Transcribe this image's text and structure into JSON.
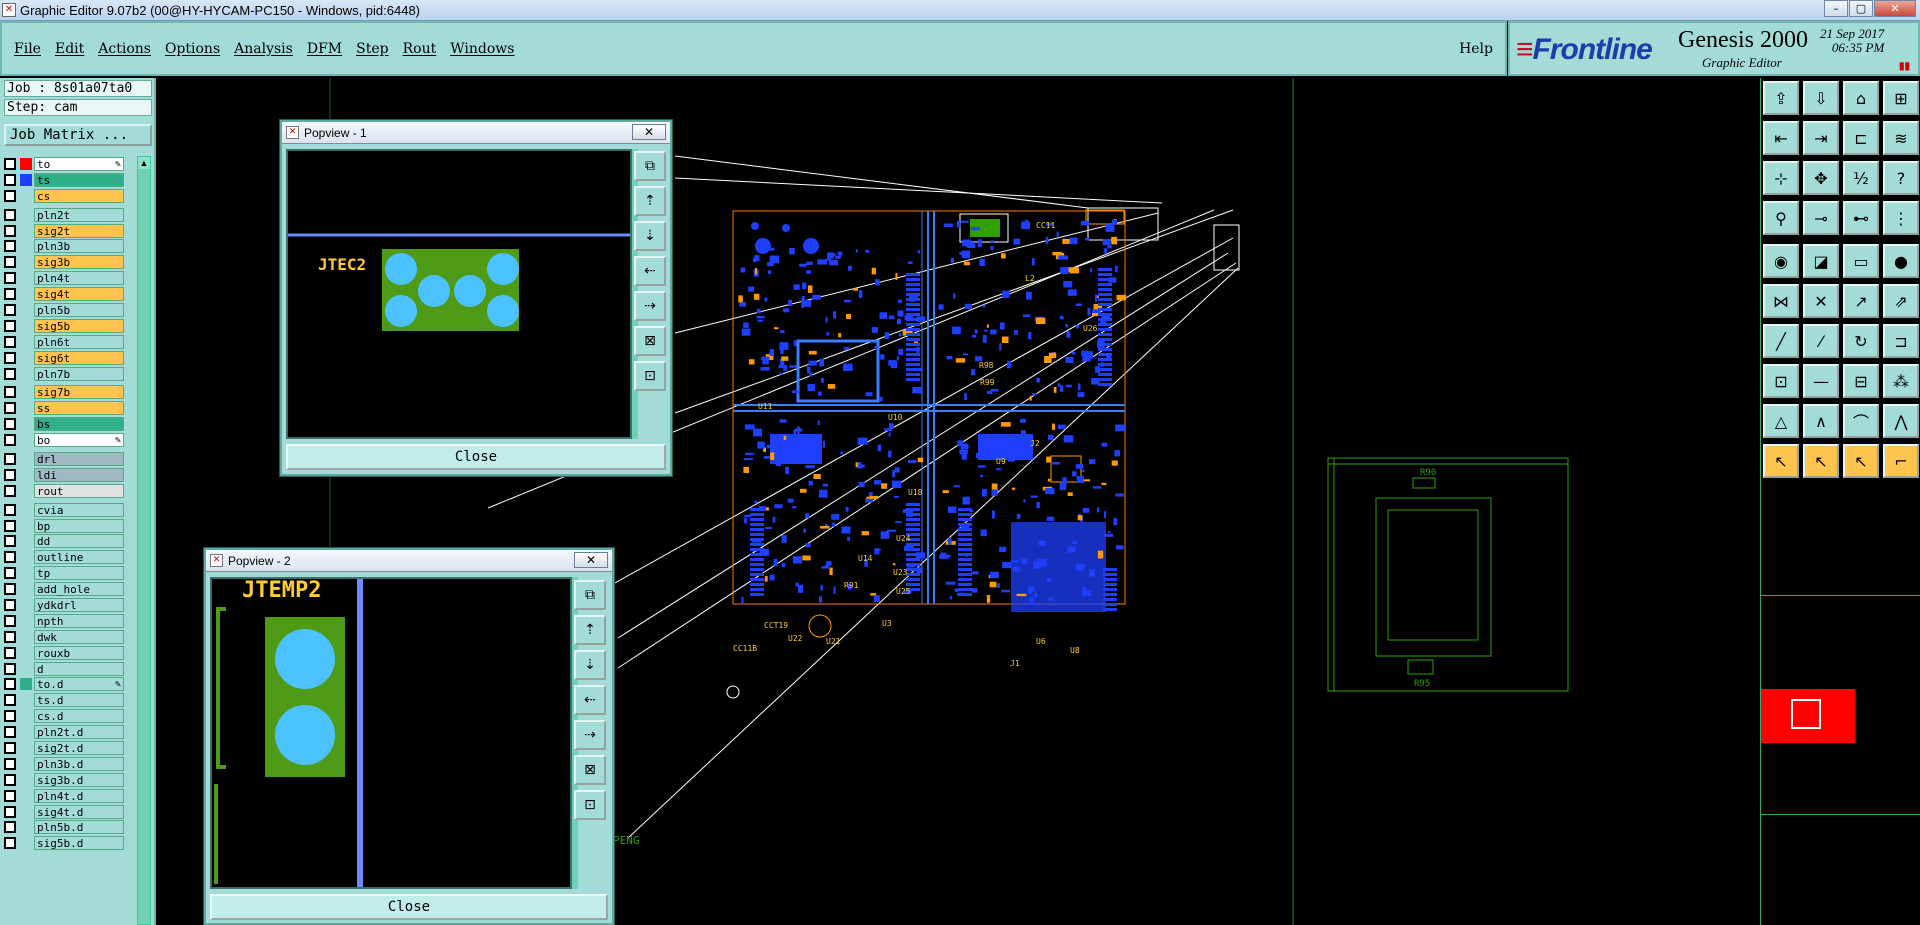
{
  "window": {
    "title": "Graphic Editor 9.07b2 (00@HY-HYCAM-PC150 - Windows, pid:6448)",
    "minimize": "–",
    "maximize": "▢",
    "close": "✕"
  },
  "menu": {
    "items": [
      "File",
      "Edit",
      "Actions",
      "Options",
      "Analysis",
      "DFM",
      "Step",
      "Rout",
      "Windows"
    ],
    "help": "Help"
  },
  "brand": {
    "logo": "Frontline",
    "product": "Genesis 2000",
    "subtitle": "Graphic Editor",
    "date": "21 Sep 2017",
    "time": "06:35 PM"
  },
  "job": {
    "job_label": "Job : 8s01a07ta0",
    "step_label": "Step: cam",
    "matrix_button": "Job Matrix ..."
  },
  "layers": [
    {
      "name": "to",
      "swatch": "#ff0000",
      "bg": "#ffffff",
      "edit": true
    },
    {
      "name": "ts",
      "swatch": "#1f3fff",
      "bg": "#2fae8a"
    },
    {
      "name": "cs",
      "swatch": "",
      "bg": "#ffc44d"
    },
    {
      "name": "pln2t",
      "swatch": "",
      "bg": "#a3dcd6",
      "gap": true
    },
    {
      "name": "sig2t",
      "swatch": "",
      "bg": "#ffc44d"
    },
    {
      "name": "pln3b",
      "swatch": "",
      "bg": "#a3dcd6"
    },
    {
      "name": "sig3b",
      "swatch": "",
      "bg": "#ffc44d"
    },
    {
      "name": "pln4t",
      "swatch": "",
      "bg": "#a3dcd6"
    },
    {
      "name": "sig4t",
      "swatch": "",
      "bg": "#ffc44d"
    },
    {
      "name": "pln5b",
      "swatch": "",
      "bg": "#a3dcd6"
    },
    {
      "name": "sig5b",
      "swatch": "",
      "bg": "#ffc44d"
    },
    {
      "name": "pln6t",
      "swatch": "",
      "bg": "#a3dcd6"
    },
    {
      "name": "sig6t",
      "swatch": "",
      "bg": "#ffc44d"
    },
    {
      "name": "pln7b",
      "swatch": "",
      "bg": "#a3dcd6"
    },
    {
      "name": "sig7b",
      "swatch": "",
      "bg": "#ffc44d",
      "gap": true
    },
    {
      "name": "ss",
      "swatch": "",
      "bg": "#ffc44d"
    },
    {
      "name": "bs",
      "swatch": "",
      "bg": "#2fae8a"
    },
    {
      "name": "bo",
      "swatch": "",
      "bg": "#ffffff",
      "edit": true
    },
    {
      "name": "drl",
      "swatch": "",
      "bg": "#9fb8c4",
      "gap": true
    },
    {
      "name": "ldi",
      "swatch": "",
      "bg": "#9fb8c4"
    },
    {
      "name": "rout",
      "swatch": "",
      "bg": "#e2e2e2"
    },
    {
      "name": "cvia",
      "swatch": "",
      "bg": "#a3dcd6",
      "gap": true
    },
    {
      "name": "bp",
      "swatch": "",
      "bg": "#a3dcd6"
    },
    {
      "name": "dd",
      "swatch": "",
      "bg": "#a3dcd6"
    },
    {
      "name": "outline",
      "swatch": "",
      "bg": "#a3dcd6"
    },
    {
      "name": "tp",
      "swatch": "",
      "bg": "#a3dcd6"
    },
    {
      "name": "add_hole",
      "swatch": "",
      "bg": "#a3dcd6"
    },
    {
      "name": "ydkdrl",
      "swatch": "",
      "bg": "#a3dcd6"
    },
    {
      "name": "npth",
      "swatch": "",
      "bg": "#a3dcd6"
    },
    {
      "name": "dwk",
      "swatch": "",
      "bg": "#a3dcd6"
    },
    {
      "name": "rouxb",
      "swatch": "",
      "bg": "#a3dcd6"
    },
    {
      "name": "d",
      "swatch": "",
      "bg": "#a3dcd6"
    },
    {
      "name": "to.d",
      "swatch": "#2fae8a",
      "bg": "#a3dcd6",
      "edit": true
    },
    {
      "name": "ts.d",
      "swatch": "",
      "bg": "#a3dcd6"
    },
    {
      "name": "cs.d",
      "swatch": "",
      "bg": "#a3dcd6"
    },
    {
      "name": "pln2t.d",
      "swatch": "",
      "bg": "#a3dcd6"
    },
    {
      "name": "sig2t.d",
      "swatch": "",
      "bg": "#a3dcd6"
    },
    {
      "name": "pln3b.d",
      "swatch": "",
      "bg": "#a3dcd6"
    },
    {
      "name": "sig3b.d",
      "swatch": "",
      "bg": "#a3dcd6"
    },
    {
      "name": "pln4t.d",
      "swatch": "",
      "bg": "#a3dcd6"
    },
    {
      "name": "sig4t.d",
      "swatch": "",
      "bg": "#a3dcd6"
    },
    {
      "name": "pln5b.d",
      "swatch": "",
      "bg": "#a3dcd6"
    },
    {
      "name": "sig5b.d",
      "swatch": "",
      "bg": "#a3dcd6"
    }
  ],
  "popups": [
    {
      "title": "Popview - 1",
      "close_x": "✕",
      "label": "JTEC2",
      "close_button": "Close"
    },
    {
      "title": "Popview - 2",
      "close_x": "✕",
      "label": "JTEMP2",
      "close_button": "Close"
    }
  ],
  "pcb": {
    "labels": [
      "CC11",
      "L2",
      "U11",
      "U10",
      "U18",
      "U24",
      "U14",
      "U23",
      "U25",
      "U3",
      "U22",
      "U21",
      "U9",
      "U6",
      "U8",
      "J1",
      "J2",
      "R98",
      "R99",
      "R91",
      "CCT19",
      "CC11B",
      "U26",
      "PENG"
    ]
  },
  "secondary_board": {
    "labels": [
      "R90",
      "R95"
    ]
  },
  "colors": {
    "panel": "#a3dcd6",
    "accent": "#1f3fff",
    "copper": "#ff9900",
    "solder": "#2ea000",
    "pad": "#4cc3ff",
    "highlight": "#ff0000"
  }
}
